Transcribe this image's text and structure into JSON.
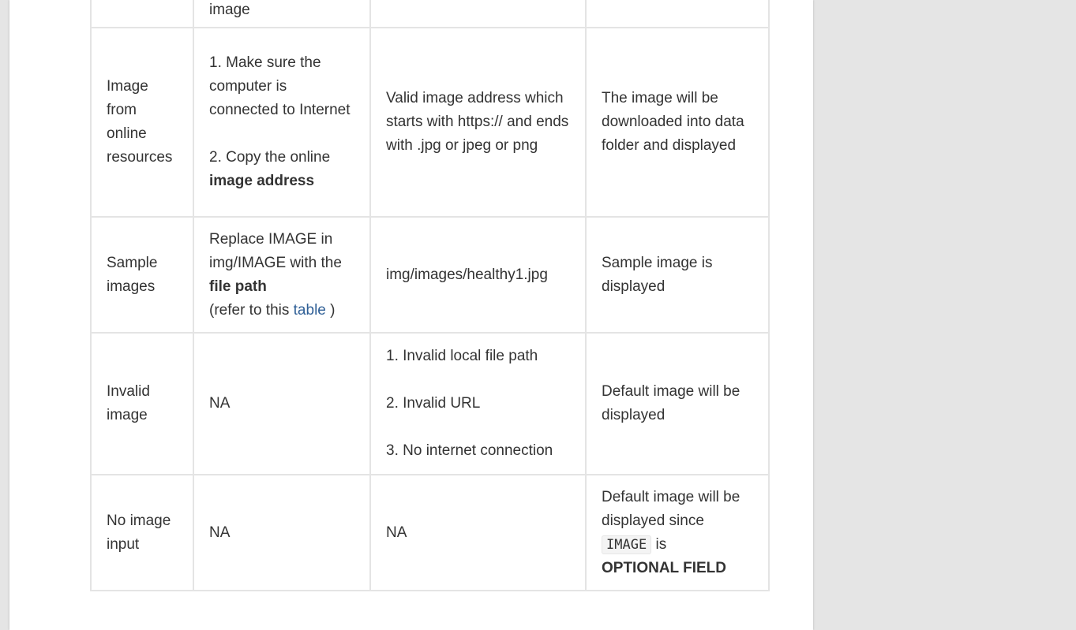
{
  "rows": [
    {
      "col2_fragment": "image"
    },
    {
      "source": "Image from online resources",
      "steps": {
        "step1": "1. Make sure the computer is connected to Internet",
        "step2_prefix": "2. Copy the online",
        "step2_bold": "image address"
      },
      "input": "Valid image address which starts with https:// and ends with .jpg or jpeg or png",
      "result": "The image will be downloaded into data folder and displayed"
    },
    {
      "source": "Sample images",
      "steps": {
        "text": "Replace IMAGE in img/IMAGE with the",
        "bold": "file path",
        "refer_prefix": "(refer to this",
        "link": "table",
        "refer_suffix": ")"
      },
      "input": "img/images/healthy1.jpg",
      "result": "Sample image is displayed"
    },
    {
      "source": "Invalid image",
      "steps": "NA",
      "input": {
        "item1": "1. Invalid local file path",
        "item2": "2. Invalid URL",
        "item3": "3. No internet connection"
      },
      "result": "Default image will be displayed"
    },
    {
      "source": "No image input",
      "steps": "NA",
      "input": "NA",
      "result": {
        "prefix": "Default image will be displayed since",
        "code": "IMAGE",
        "middle": "is",
        "bold": "OPTIONAL FIELD"
      }
    }
  ],
  "colors": {
    "page_background": "#ffffff",
    "outer_background": "#e5e5e5",
    "border": "#e4e4e4",
    "text": "#333333",
    "link": "#2f5f96"
  }
}
